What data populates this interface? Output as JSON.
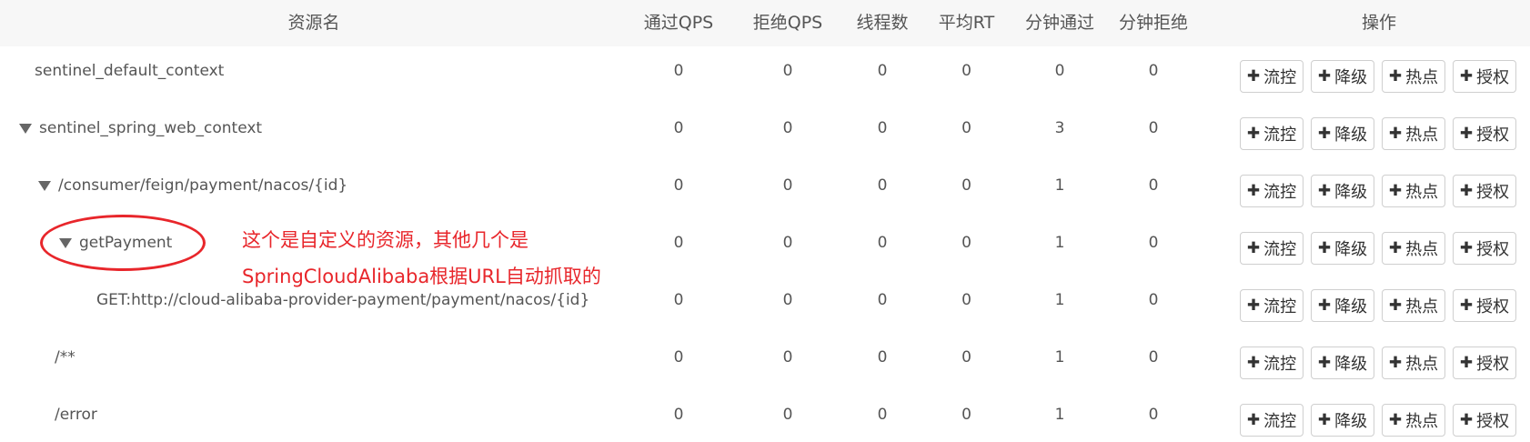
{
  "table": {
    "headers": {
      "resource": "资源名",
      "pass_qps": "通过QPS",
      "block_qps": "拒绝QPS",
      "threads": "线程数",
      "avg_rt": "平均RT",
      "minute_pass": "分钟通过",
      "minute_block": "分钟拒绝",
      "actions": "操作"
    },
    "rows": [
      {
        "name": "sentinel_default_context",
        "expandable": false,
        "pass_qps": "0",
        "block_qps": "0",
        "threads": "0",
        "avg_rt": "0",
        "minute_pass": "0",
        "minute_block": "0"
      },
      {
        "name": "sentinel_spring_web_context",
        "expandable": true,
        "pass_qps": "0",
        "block_qps": "0",
        "threads": "0",
        "avg_rt": "0",
        "minute_pass": "3",
        "minute_block": "0"
      },
      {
        "name": "/consumer/feign/payment/nacos/{id}",
        "expandable": true,
        "pass_qps": "0",
        "block_qps": "0",
        "threads": "0",
        "avg_rt": "0",
        "minute_pass": "1",
        "minute_block": "0"
      },
      {
        "name": "getPayment",
        "expandable": true,
        "pass_qps": "0",
        "block_qps": "0",
        "threads": "0",
        "avg_rt": "0",
        "minute_pass": "1",
        "minute_block": "0"
      },
      {
        "name": "GET:http://cloud-alibaba-provider-payment/payment/nacos/{id}",
        "expandable": false,
        "pass_qps": "0",
        "block_qps": "0",
        "threads": "0",
        "avg_rt": "0",
        "minute_pass": "1",
        "minute_block": "0"
      },
      {
        "name": "/**",
        "expandable": false,
        "pass_qps": "0",
        "block_qps": "0",
        "threads": "0",
        "avg_rt": "0",
        "minute_pass": "1",
        "minute_block": "0"
      },
      {
        "name": "/error",
        "expandable": false,
        "pass_qps": "0",
        "block_qps": "0",
        "threads": "0",
        "avg_rt": "0",
        "minute_pass": "1",
        "minute_block": "0"
      }
    ]
  },
  "actions": {
    "flow": "流控",
    "degrade": "降级",
    "hotspot": "热点",
    "authority": "授权"
  },
  "annotation": {
    "line1": "这个是自定义的资源，其他几个是",
    "line2": "SpringCloudAlibaba根据URL自动抓取的",
    "color": "#e8262b"
  },
  "icons": {
    "expand": "caret-down-icon",
    "add": "plus-icon"
  }
}
